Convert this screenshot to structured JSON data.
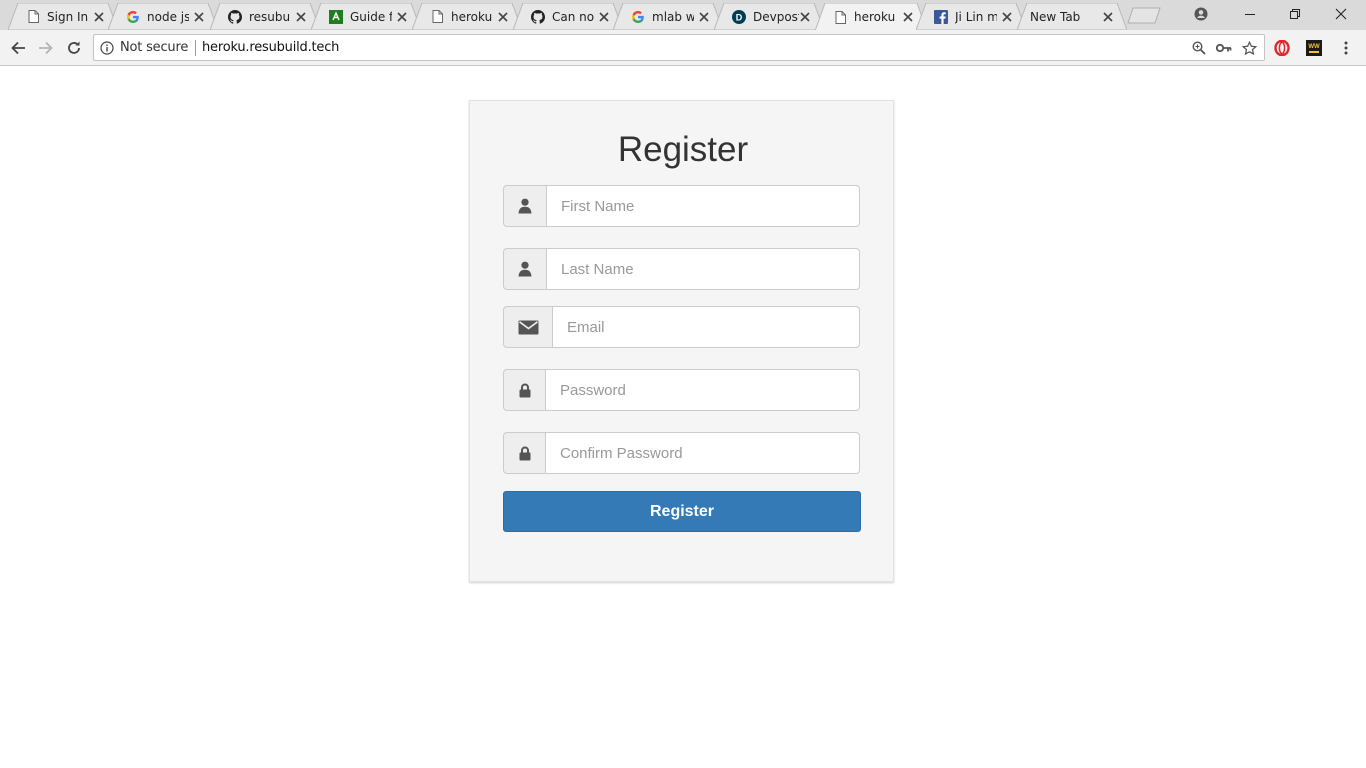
{
  "browser": {
    "tabs": [
      {
        "title": "Sign In",
        "icon": "page-icon",
        "active": false
      },
      {
        "title": "node js",
        "icon": "google-icon",
        "active": false
      },
      {
        "title": "resubuil",
        "icon": "github-icon",
        "active": false
      },
      {
        "title": "Guide fo",
        "icon": "green-app-icon",
        "active": false
      },
      {
        "title": "heroku.r",
        "icon": "page-icon",
        "active": false
      },
      {
        "title": "Can not",
        "icon": "github-icon",
        "active": false
      },
      {
        "title": "mlab wo",
        "icon": "google-icon",
        "active": false
      },
      {
        "title": "Devpost",
        "icon": "devpost-icon",
        "active": false
      },
      {
        "title": "heroku.r",
        "icon": "page-icon",
        "active": true
      },
      {
        "title": "Ji Lin m",
        "icon": "facebook-icon",
        "active": false
      },
      {
        "title": "New Tab",
        "icon": "none",
        "active": false
      }
    ],
    "security_label": "Not secure",
    "url": "heroku.resubuild.tech"
  },
  "form": {
    "title": "Register",
    "fields": [
      {
        "placeholder": "First Name",
        "icon": "user-icon"
      },
      {
        "placeholder": "Last Name",
        "icon": "user-icon"
      },
      {
        "placeholder": "Email",
        "icon": "envelope-icon"
      },
      {
        "placeholder": "Password",
        "icon": "lock-icon"
      },
      {
        "placeholder": "Confirm Password",
        "icon": "lock-icon"
      }
    ],
    "submit_label": "Register"
  },
  "colors": {
    "primary_button": "#337ab7",
    "card_background": "#f5f5f5",
    "tabstrip": "#dadada"
  }
}
